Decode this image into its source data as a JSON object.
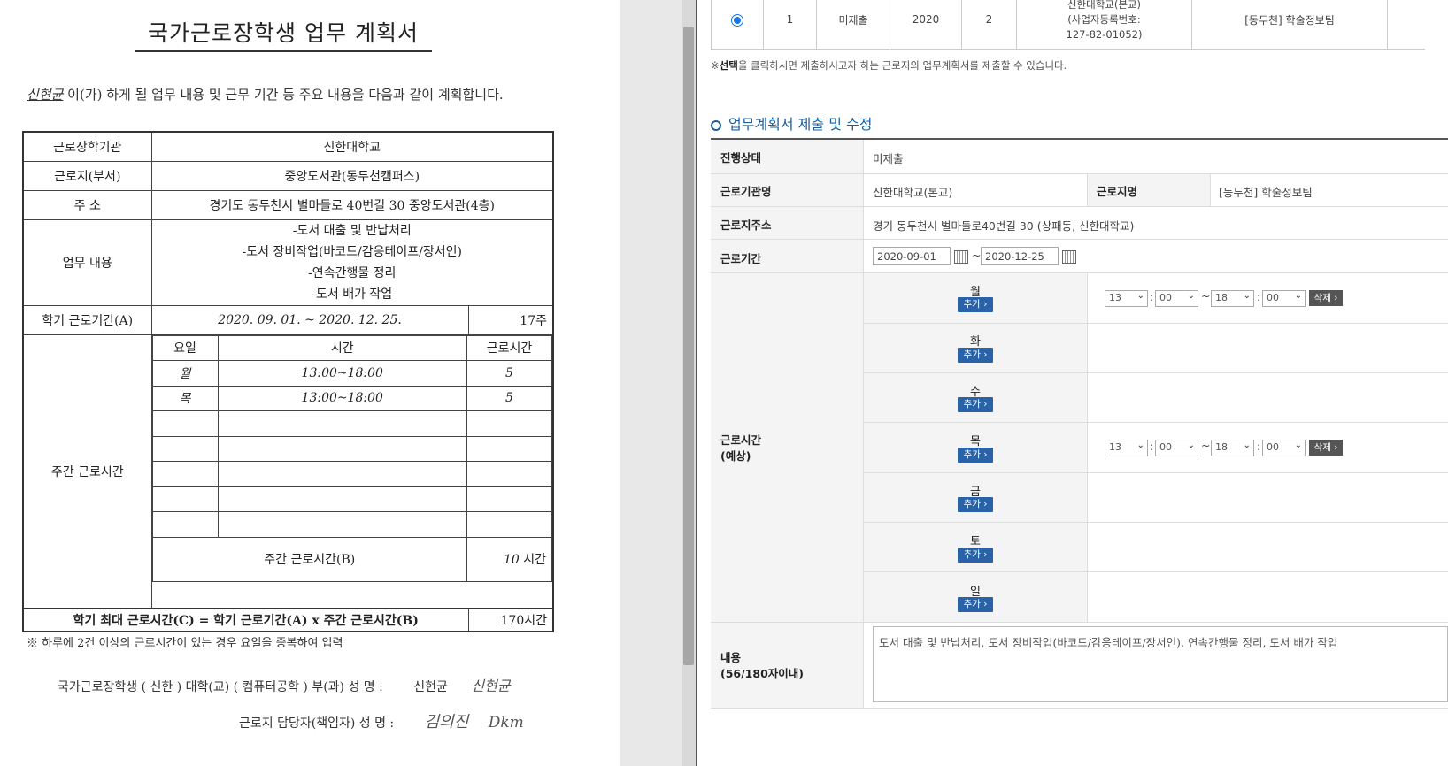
{
  "doc": {
    "title": "국가근로장학생 업무 계획서",
    "intro_name": "신현균",
    "intro_rest": " 이(가) 하게 될 업무 내용 및 근무 기간 등 주요 내용을 다음과 같이 계획합니다.",
    "rows": {
      "org_label": "근로장학기관",
      "org_value": "신한대학교",
      "dept_label": "근로지(부서)",
      "dept_value": "중앙도서관(동두천캠퍼스)",
      "addr_label": "주 소",
      "addr_value": "경기도 동두천시 벌마들로 40번길 30 중앙도서관(4층)",
      "duty_label": "업무 내용",
      "duties": [
        "-도서 대출 및 반납처리",
        "-도서 장비작업(바코드/감응테이프/장서인)",
        "-연속간행물 정리",
        "-도서 배가 작업"
      ],
      "period_label": "학기 근로기간(A)",
      "period_value": "2020. 09. 01. ~ 2020. 12. 25.",
      "period_weeks": "17주",
      "weekly_label": "주간 근로시간",
      "col_day": "요일",
      "col_time": "시간",
      "col_hours": "근로시간",
      "schedule": [
        {
          "day": "월",
          "time": "13:00~18:00",
          "hours": "5"
        },
        {
          "day": "목",
          "time": "13:00~18:00",
          "hours": "5"
        }
      ],
      "weekly_total_label": "주간 근로시간(B)",
      "weekly_total_value": "10",
      "weekly_total_unit": " 시간",
      "max_label": "학기 최대 근로시간(C) = 학기 근로기간(A) x  주간 근로시간(B)",
      "max_value": "170시간"
    },
    "note": "※ 하루에 2건 이상의 근로시간이 있는 경우 요일을 중복하여 입력",
    "sig1_text": "국가근로장학생 ( 신한 ) 대학(교) ( 컴퓨터공학 ) 부(과)    성  명 :",
    "sig1_name": "신현균",
    "sig1_sign": "신현균",
    "sig2_text": "근로지 담당자(책임자)    성  명 :",
    "sig2_name": "김의진",
    "sig2_sign": "Dkm"
  },
  "web": {
    "top_row": {
      "no": "1",
      "status": "미제출",
      "year": "2020",
      "term": "2",
      "org_line1": "신한대학교(본교)",
      "org_line2": "(사업자등록번호:",
      "org_line3": "127-82-01052)",
      "dept": "[동두천] 학술정보팀"
    },
    "notice_bold": "선택",
    "notice_pre": "※",
    "notice_rest": "을 클릭하시면 제출하시고자 하는 근로지의 업무계획서를 제출할 수 있습니다.",
    "section_title": "업무계획서 제출 및 수정",
    "status_label": "진행상태",
    "status_value": "미제출",
    "org_label": "근로기관명",
    "org_value": "신한대학교(본교)",
    "site_label": "근로지명",
    "site_value": "[동두천] 학술정보팀",
    "addr_label": "근로지주소",
    "addr_value": "경기 동두천시 벌마들로40번길 30 (상패동, 신한대학교)",
    "period_label": "근로기간",
    "start_date": "2020-09-01",
    "end_date": "2020-12-25",
    "tilde": "~",
    "hours_label_1": "근로시간",
    "hours_label_2": "(예상)",
    "add_label": "추가 ›",
    "del_label": "삭제 ›",
    "days": [
      "월",
      "화",
      "수",
      "목",
      "금",
      "토",
      "일"
    ],
    "mon": {
      "h1": "13",
      "m1": "00",
      "h2": "18",
      "m2": "00"
    },
    "thu": {
      "h1": "13",
      "m1": "00",
      "h2": "18",
      "m2": "00"
    },
    "colon": ":",
    "content_label_1": "내용",
    "content_label_2": "(56/180자이내)",
    "content_value": "도서 대출 및 반납처리, 도서 장비작업(바코드/감응테이프/장서인), 연속간행물 정리, 도서 배가 작업"
  }
}
